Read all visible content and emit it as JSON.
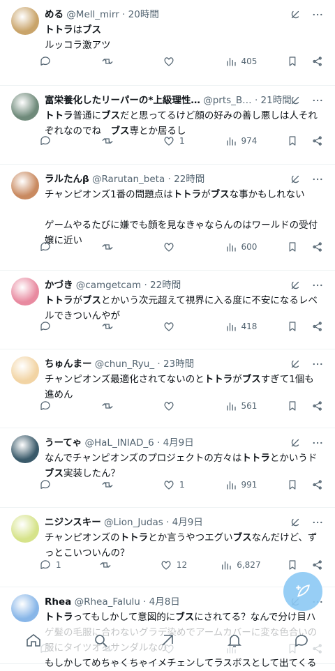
{
  "colors": {
    "text": "#0f1419",
    "muted": "#536471",
    "accent": "#1d9bf0",
    "divider": "#eff3f4"
  },
  "tweets": [
    {
      "name": "める",
      "handle": "@Mell_mirr",
      "sep": " · ",
      "time": "20時間",
      "body_html": "<span class=\"hot\">トトラ</span>は<span class=\"hot\">ブス</span>\nルッコラ激アツ",
      "reply": "",
      "retweet": "",
      "like": "",
      "views": "405"
    },
    {
      "name": "富栄養化したリーパーの*上級理性…",
      "handle": "@prts_B…",
      "sep": " · ",
      "time": "21時間",
      "body_html": "<span class=\"hot\">トトラ</span>普通に<span class=\"hot\">ブス</span>だと思ってるけど顔の好みの善し悪しは人それぞれなのでね　<span class=\"hot\">ブス</span>専とか居るし",
      "reply": "",
      "retweet": "",
      "like": "1",
      "views": "974"
    },
    {
      "name": "ラルたんβ",
      "handle": "@Rarutan_beta",
      "sep": " · ",
      "time": "22時間",
      "body_html": "チャンピオンズ1番の問題点は<span class=\"hot\">トトラ</span>が<span class=\"hot\">ブス</span>な事かもしれない\n\nゲームやるたびに嫌でも顔を見なきゃならんのはワールドの受付嬢に近い",
      "reply": "",
      "retweet": "",
      "like": "",
      "views": "600"
    },
    {
      "name": "かづき",
      "handle": "@camgetcam",
      "sep": " · ",
      "time": "22時間",
      "body_html": "<span class=\"hot\">トトラ</span>が<span class=\"hot\">ブス</span>とかいう次元超えて視界に入る度に不安になるレベルできついんやが",
      "reply": "",
      "retweet": "",
      "like": "",
      "views": "418"
    },
    {
      "name": "ちゅんまー",
      "handle": "@chun_Ryu_",
      "sep": " · ",
      "time": "23時間",
      "body_html": "チャンピオンズ最適化されてないのと<span class=\"hot\">トトラ</span>が<span class=\"hot\">ブス</span>すぎて1個も進めん",
      "reply": "",
      "retweet": "",
      "like": "",
      "views": "561"
    },
    {
      "name": "うーてゃ",
      "handle": "@HaL_INIAD_6",
      "sep": " · ",
      "time": "4月9日",
      "body_html": "なんでチャンピオンズのプロジェクトの方々は<span class=\"hot\">トトラ</span>とかいうド<span class=\"hot\">ブス</span>実装したん？",
      "reply": "",
      "retweet": "",
      "like": "1",
      "views": "991"
    },
    {
      "name": "ニジンスキー",
      "handle": "@Lion_Judas",
      "sep": " · ",
      "time": "4月9日",
      "body_html": "チャンピオンズの<span class=\"hot\">トトラ</span>とか言うやつエグい<span class=\"hot\">ブス</span>なんだけど、ずっとこいついんの？",
      "reply": "1",
      "retweet": "",
      "like": "12",
      "views": "6,827"
    },
    {
      "name": "Rhea",
      "handle": "@Rhea_Falulu",
      "sep": " · ",
      "time": "4月8日",
      "body_html": "<span class=\"hot\">トトラ</span>ってもしかして意図的に<span class=\"hot\">ブス</span>にされてる？なんで分け目ハゲ髪の毛服に合わないグラデ染めでアームカバーに変な色合いの服にタイツオンサンダルなの\nもしかしてめちゃくちゃイメチェンしてラスボスとして出てくる",
      "reply": "",
      "retweet": "",
      "like": "",
      "views": ""
    }
  ]
}
